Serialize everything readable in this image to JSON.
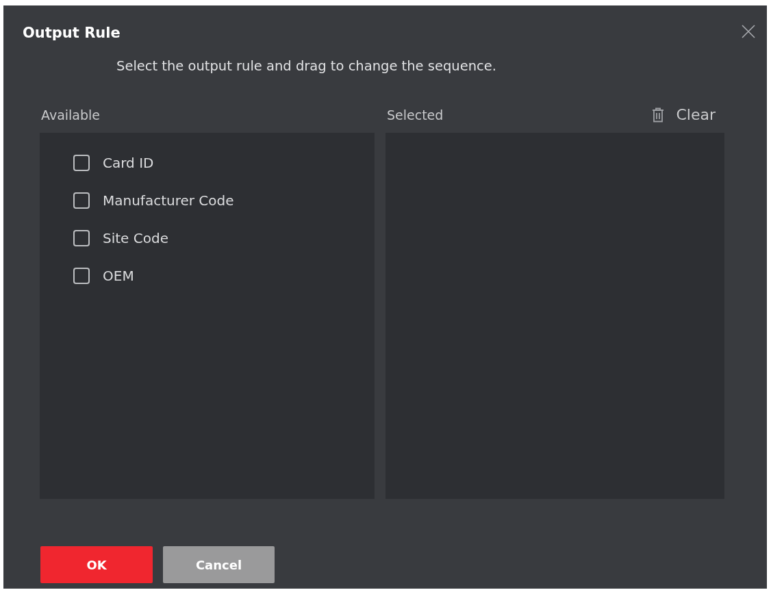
{
  "dialog": {
    "title": "Output Rule",
    "instruction": "Select the output rule and drag to change the sequence."
  },
  "available": {
    "label": "Available",
    "items": [
      {
        "label": "Card ID",
        "checked": false
      },
      {
        "label": "Manufacturer Code",
        "checked": false
      },
      {
        "label": "Site Code",
        "checked": false
      },
      {
        "label": "OEM",
        "checked": false
      }
    ]
  },
  "selected": {
    "label": "Selected",
    "clear_button": "Clear"
  },
  "buttons": [
    {
      "label": "OK",
      "kind": "primary"
    },
    {
      "label": "Cancel",
      "kind": "secondary"
    }
  ]
}
